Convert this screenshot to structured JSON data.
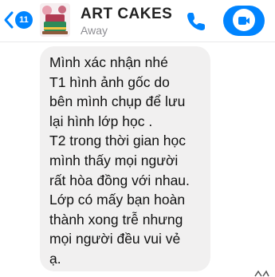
{
  "header": {
    "unread_count": "11",
    "contact_name": "ART CAKES",
    "status": "Away",
    "colors": {
      "accent": "#0084ff",
      "bubble": "#f1f0f0",
      "status_text": "#8e8e93"
    },
    "icons": [
      "back-chevron-icon",
      "phone-icon",
      "video-call-icon"
    ]
  },
  "message": {
    "lines": [
      "Mình xác nhận nhé",
      "T1 hình ảnh gốc do",
      "bên mình chụp để lưu",
      "lại hình lớp học .",
      "T2 trong thời gian học",
      "mình thấy mọi người",
      "rất hòa đồng với nhau.",
      "Lớp có mấy bạn hoàn",
      "thành xong trễ nhưng",
      "mọi người đều vui vẻ",
      "ạ."
    ]
  }
}
